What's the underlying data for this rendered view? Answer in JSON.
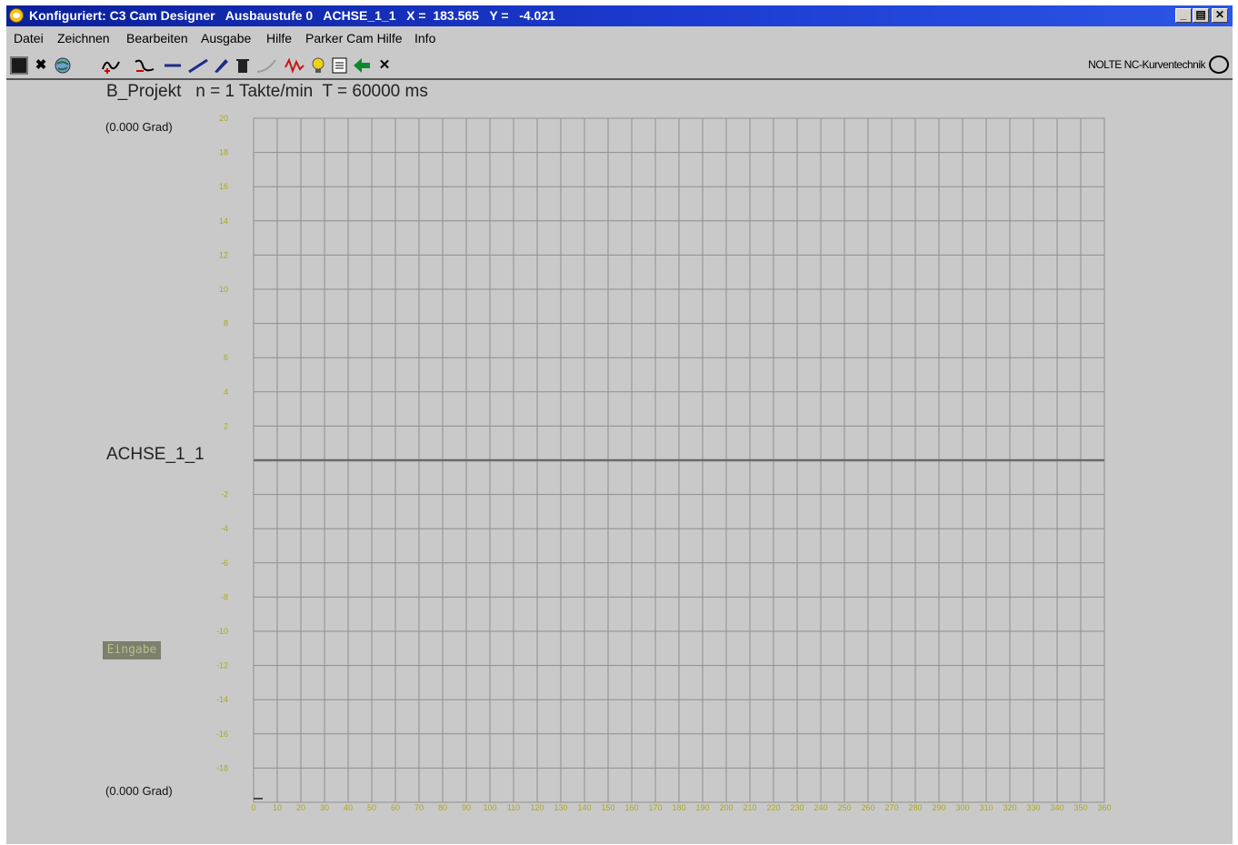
{
  "window": {
    "title": "Konfiguriert: C3 Cam Designer   Ausbaustufe 0   ACHSE_1_1   X =  183.565   Y =   -4.021",
    "controls": [
      "minimize-icon",
      "restore-icon",
      "close-icon"
    ]
  },
  "menu": [
    "Datei",
    "Zeichnen",
    "Bearbeiten",
    "Ausgabe",
    "Hilfe",
    "Parker Cam Hilfe",
    "Info"
  ],
  "toolbar": {
    "buttons": [
      "stop-icon",
      "cross-icon",
      "world-icon",
      "curve-add-icon",
      "curve-icon",
      "line-icon",
      "ramp-icon",
      "pen-icon",
      "trash-icon",
      "spline-icon",
      "wave-icon",
      "light-icon",
      "list-icon",
      "back-arrow-icon",
      "close-icon"
    ]
  },
  "brand": "NOLTE NC-Kurventechnik",
  "header": {
    "project": "B_Projekt",
    "speed": "n = 1 Takte/min",
    "period": "T = 60000 ms"
  },
  "y_top_label": "(0.000 Grad)",
  "y_bottom_label": "(0.000 Grad)",
  "axis_name": "ACHSE_1_1",
  "input_label": "Eingabe",
  "colors": {
    "tick_label": "#a8aa1e",
    "grid": "#8f8f8f",
    "window_bg": "#c9c9c9",
    "title_bar": "#1c3bd0",
    "curve": "#6a6a6a"
  },
  "chart_data": {
    "type": "line",
    "x": [
      0,
      360
    ],
    "series": [
      {
        "values": [
          0,
          0
        ]
      }
    ],
    "xlim": [
      0,
      360
    ],
    "ylim": [
      -20,
      20
    ],
    "x_ticks": [
      0,
      10,
      20,
      30,
      40,
      50,
      60,
      70,
      80,
      90,
      100,
      110,
      120,
      130,
      140,
      150,
      160,
      170,
      180,
      190,
      200,
      210,
      220,
      230,
      240,
      250,
      260,
      270,
      280,
      290,
      300,
      310,
      320,
      330,
      340,
      350,
      360
    ],
    "y_ticks": [
      20,
      18,
      16,
      14,
      12,
      10,
      8,
      6,
      4,
      2,
      -2,
      -4,
      -6,
      -8,
      -10,
      -12,
      -14,
      -16,
      -18
    ],
    "grid": true
  }
}
